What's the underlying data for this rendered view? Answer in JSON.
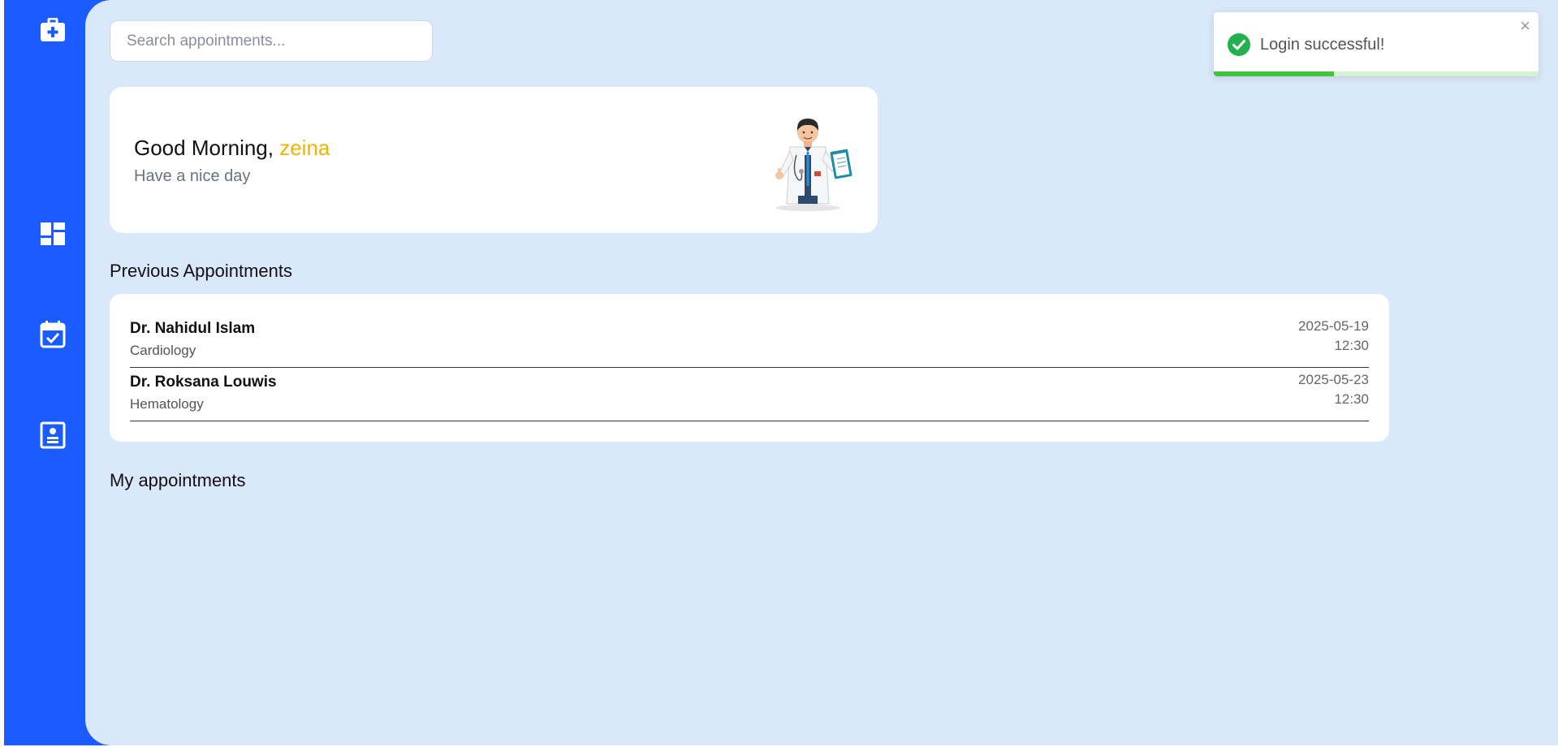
{
  "sidebar": {
    "icons": [
      "medical-kit-icon",
      "dashboard-icon",
      "calendar-check-icon",
      "contact-card-icon"
    ],
    "accent": "#1a5cff"
  },
  "search": {
    "placeholder": "Search appointments..."
  },
  "greeting": {
    "prefix": "Good Morning, ",
    "name": "zeina",
    "subtitle": "Have a nice day",
    "name_color": "#f0b400"
  },
  "previous": {
    "title": "Previous Appointments",
    "items": [
      {
        "doctor": "Dr. Nahidul Islam",
        "specialty": "Cardiology",
        "date": "2025-05-19",
        "time": "12:30"
      },
      {
        "doctor": "Dr. Roksana Louwis",
        "specialty": "Hematology",
        "date": "2025-05-23",
        "time": "12:30"
      }
    ]
  },
  "my_appointments": {
    "title": "My appointments"
  },
  "toast": {
    "message": "Login successful!",
    "close": "×",
    "progress": 0.37,
    "status_color": "#3fc43f"
  }
}
